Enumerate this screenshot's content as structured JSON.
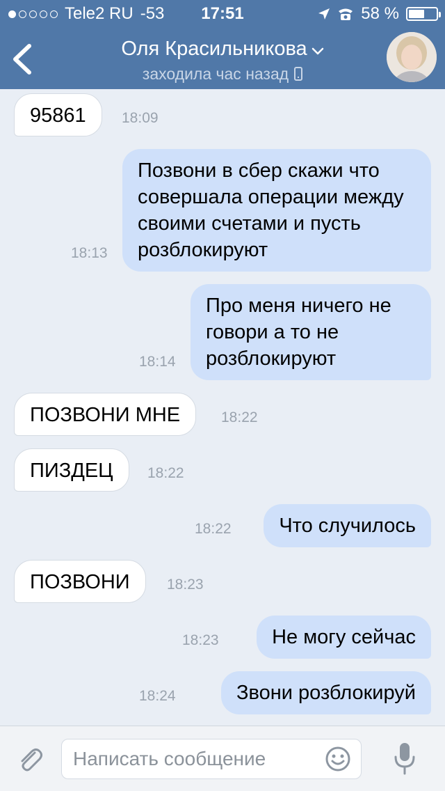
{
  "status_bar": {
    "carrier": "Tele2 RU",
    "signal_strength": "-53",
    "time": "17:51",
    "battery_percent": "58 %",
    "battery_level": 0.58
  },
  "header": {
    "contact_name": "Оля Красильникова",
    "last_seen": "заходила час назад"
  },
  "messages": [
    {
      "direction": "in",
      "text": "95861",
      "time": "18:09"
    },
    {
      "direction": "out",
      "text": "Позвони в сбер скажи что совершала операции между своими счетами и пусть розблокируют",
      "time": "18:13"
    },
    {
      "direction": "out",
      "text": "Про меня ничего не говори а то не розблокируют",
      "time": "18:14"
    },
    {
      "direction": "in",
      "text": "ПОЗВОНИ МНЕ",
      "time": "18:22"
    },
    {
      "direction": "in",
      "text": "ПИЗДЕЦ",
      "time": "18:22"
    },
    {
      "direction": "out",
      "text": "Что случилось",
      "time": "18:22"
    },
    {
      "direction": "in",
      "text": "ПОЗВОНИ",
      "time": "18:23"
    },
    {
      "direction": "out",
      "text": "Не могу сейчас",
      "time": "18:23"
    },
    {
      "direction": "out",
      "text": "Звони розблокируй",
      "time": "18:24"
    }
  ],
  "composer": {
    "placeholder": "Написать сообщение"
  },
  "colors": {
    "header_bg": "#5078a8",
    "chat_bg": "#e9eef5",
    "outgoing_bubble": "#cfe0fa",
    "incoming_bubble": "#ffffff"
  },
  "icons": [
    "back-chevron-icon",
    "dropdown-chevron-icon",
    "phone-icon",
    "location-arrow-icon",
    "alarm-icon",
    "battery-icon",
    "paperclip-icon",
    "smile-icon",
    "microphone-icon"
  ]
}
